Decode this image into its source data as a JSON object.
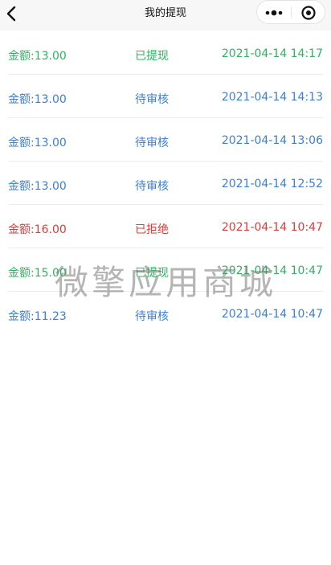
{
  "navbar": {
    "title": "我的提现",
    "back_icon": "chevron-left-icon",
    "menu_icon": "more-dots-icon",
    "close_icon": "target-circle-icon"
  },
  "colors": {
    "success": "#2db35f",
    "pending": "#3b7fd6",
    "rejected": "#e03a3a"
  },
  "records": [
    {
      "amount": "金额:13.00",
      "status": "已提现",
      "time": "2021-04-14 14:17",
      "state": "success"
    },
    {
      "amount": "金额:13.00",
      "status": "待审核",
      "time": "2021-04-14 14:13",
      "state": "pending"
    },
    {
      "amount": "金额:13.00",
      "status": "待审核",
      "time": "2021-04-14 13:06",
      "state": "pending"
    },
    {
      "amount": "金额:13.00",
      "status": "待审核",
      "time": "2021-04-14 12:52",
      "state": "pending"
    },
    {
      "amount": "金额:16.00",
      "status": "已拒绝",
      "time": "2021-04-14 10:47",
      "state": "rejected"
    },
    {
      "amount": "金额:15.00",
      "status": "已提现",
      "time": "2021-04-14 10:47",
      "state": "success"
    },
    {
      "amount": "金额:11.23",
      "status": "待审核",
      "time": "2021-04-14 10:47",
      "state": "pending"
    }
  ],
  "watermark": "微擎应用商城"
}
